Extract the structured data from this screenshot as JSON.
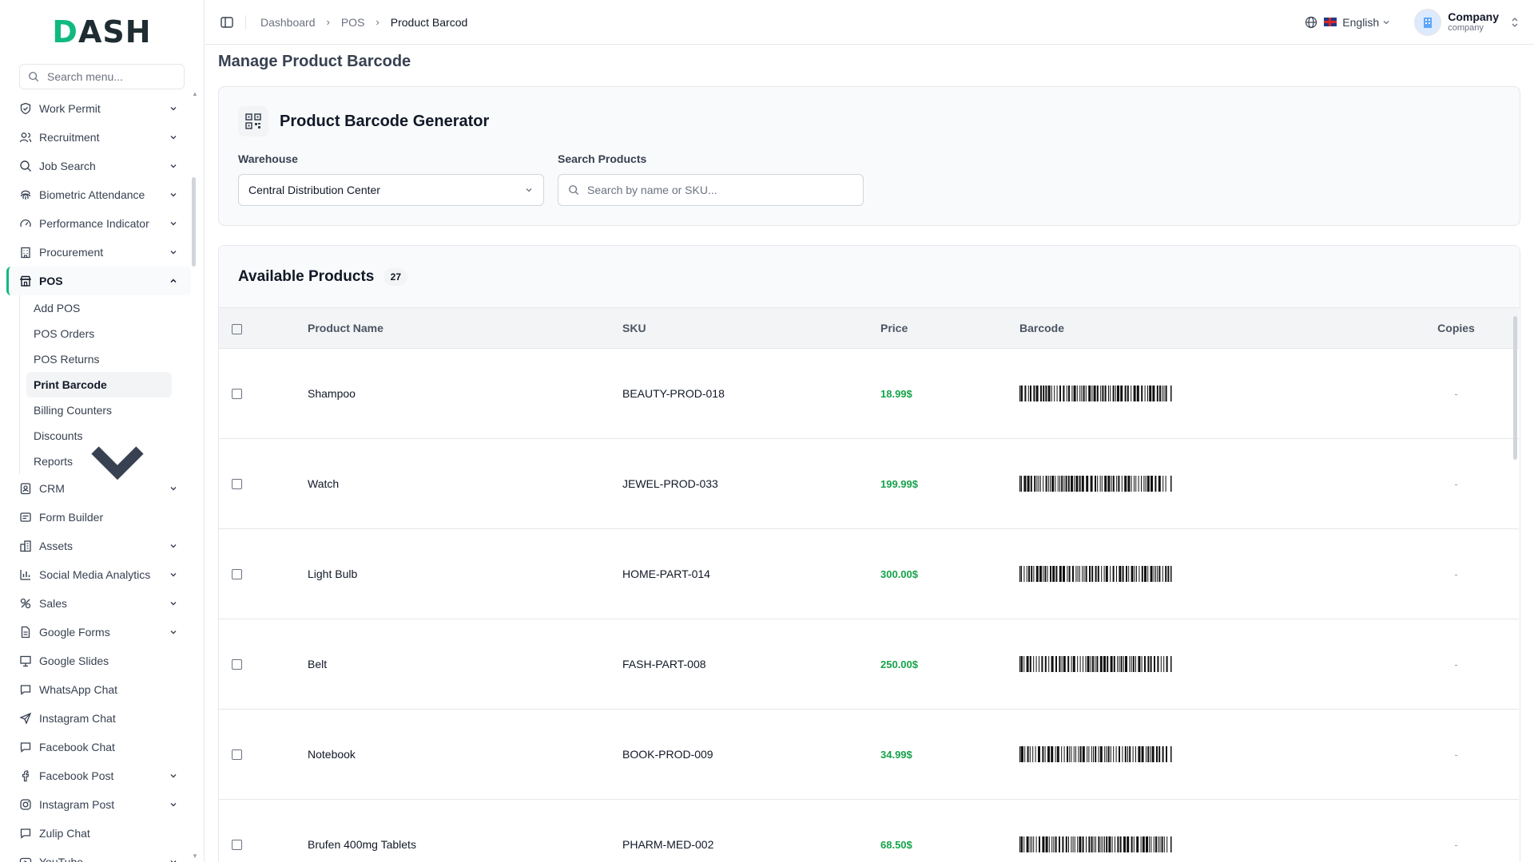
{
  "brand": {
    "logo_mark": "D",
    "logo_text": "ASH"
  },
  "sidebar": {
    "search_placeholder": "Search menu...",
    "items_top": [
      {
        "label": "Work Permit",
        "icon": "shield-check-icon",
        "has_children": true
      },
      {
        "label": "Recruitment",
        "icon": "users-icon",
        "has_children": true
      },
      {
        "label": "Job Search",
        "icon": "search-icon",
        "has_children": true
      },
      {
        "label": "Biometric Attendance",
        "icon": "fingerprint-icon",
        "has_children": true
      },
      {
        "label": "Performance Indicator",
        "icon": "gauge-icon",
        "has_children": true
      },
      {
        "label": "Procurement",
        "icon": "building-icon",
        "has_children": true
      }
    ],
    "active_item": {
      "label": "POS",
      "icon": "store-icon"
    },
    "sub_items": [
      {
        "label": "Add POS"
      },
      {
        "label": "POS Orders"
      },
      {
        "label": "POS Returns"
      },
      {
        "label": "Print Barcode",
        "active": true
      },
      {
        "label": "Billing Counters"
      },
      {
        "label": "Discounts"
      },
      {
        "label": "Reports",
        "has_children": true
      }
    ],
    "items_bottom": [
      {
        "label": "CRM",
        "icon": "contact-icon",
        "has_children": true
      },
      {
        "label": "Form Builder",
        "icon": "form-icon",
        "has_children": false
      },
      {
        "label": "Assets",
        "icon": "assets-icon",
        "has_children": true
      },
      {
        "label": "Social Media Analytics",
        "icon": "bar-chart-icon",
        "has_children": true
      },
      {
        "label": "Sales",
        "icon": "sales-icon",
        "has_children": true
      },
      {
        "label": "Google Forms",
        "icon": "document-icon",
        "has_children": true
      },
      {
        "label": "Google Slides",
        "icon": "presentation-icon",
        "has_children": false
      },
      {
        "label": "WhatsApp Chat",
        "icon": "chat-icon",
        "has_children": false
      },
      {
        "label": "Instagram Chat",
        "icon": "send-icon",
        "has_children": false
      },
      {
        "label": "Facebook Chat",
        "icon": "chat-icon",
        "has_children": false
      },
      {
        "label": "Facebook Post",
        "icon": "facebook-icon",
        "has_children": true
      },
      {
        "label": "Instagram Post",
        "icon": "instagram-icon",
        "has_children": true
      },
      {
        "label": "Zulip Chat",
        "icon": "chat-icon",
        "has_children": false
      },
      {
        "label": "YouTube",
        "icon": "youtube-icon",
        "has_children": true
      }
    ]
  },
  "header": {
    "breadcrumb": [
      "Dashboard",
      "POS",
      "Product Barcod"
    ],
    "language": "English",
    "user_name": "Company",
    "user_role": "company"
  },
  "page": {
    "title": "Manage Product Barcode"
  },
  "generator": {
    "title": "Product Barcode Generator",
    "warehouse_label": "Warehouse",
    "warehouse_value": "Central Distribution Center",
    "search_label": "Search Products",
    "search_placeholder": "Search by name or SKU..."
  },
  "products": {
    "title": "Available Products",
    "count": "27",
    "columns": {
      "name": "Product Name",
      "sku": "SKU",
      "price": "Price",
      "barcode": "Barcode",
      "copies": "Copies"
    },
    "rows": [
      {
        "name": "Shampoo",
        "sku": "BEAUTY-PROD-018",
        "price": "18.99$",
        "copies": "-"
      },
      {
        "name": "Watch",
        "sku": "JEWEL-PROD-033",
        "price": "199.99$",
        "copies": "-"
      },
      {
        "name": "Light Bulb",
        "sku": "HOME-PART-014",
        "price": "300.00$",
        "copies": "-"
      },
      {
        "name": "Belt",
        "sku": "FASH-PART-008",
        "price": "250.00$",
        "copies": "-"
      },
      {
        "name": "Notebook",
        "sku": "BOOK-PROD-009",
        "price": "34.99$",
        "copies": "-"
      },
      {
        "name": "Brufen 400mg Tablets",
        "sku": "PHARM-MED-002",
        "price": "68.50$",
        "copies": "-"
      }
    ]
  },
  "colors": {
    "accent": "#10b981",
    "price": "#16a34a"
  }
}
